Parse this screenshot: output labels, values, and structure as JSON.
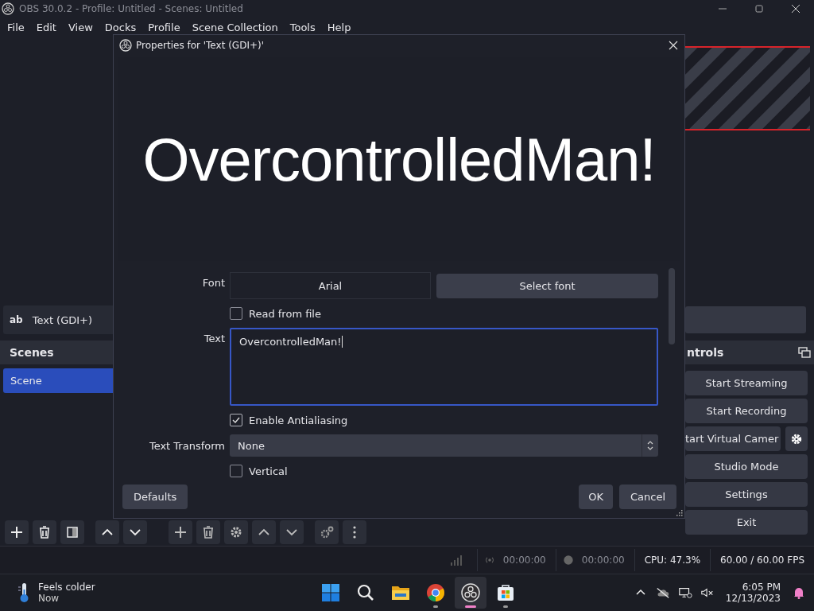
{
  "window": {
    "title": "OBS 30.0.2 - Profile: Untitled - Scenes: Untitled"
  },
  "menu": [
    "File",
    "Edit",
    "View",
    "Docks",
    "Profile",
    "Scene Collection",
    "Tools",
    "Help"
  ],
  "source_bar": {
    "badge": "ab",
    "label": "Text (GDI+)"
  },
  "scenes_dock": {
    "title": "Scenes",
    "items": [
      {
        "label": "Scene",
        "selected": true
      }
    ]
  },
  "controls_dock": {
    "title": "ntrols",
    "buttons": [
      {
        "label": "Start Streaming",
        "kind": "plain"
      },
      {
        "label": "Start Recording",
        "kind": "plain"
      },
      {
        "label": "tart Virtual Camer",
        "kind": "split"
      },
      {
        "label": "Studio Mode",
        "kind": "plain"
      },
      {
        "label": "Settings",
        "kind": "plain"
      },
      {
        "label": "Exit",
        "kind": "plain"
      }
    ]
  },
  "dialog": {
    "title": "Properties for 'Text (GDI+)'",
    "preview_text": "OvercontrolledMan!",
    "font": {
      "label": "Font",
      "value": "Arial",
      "button": "Select font"
    },
    "read_from_file": {
      "label": "Read from file",
      "checked": false
    },
    "text": {
      "label": "Text",
      "value": "OvercontrolledMan!"
    },
    "antialiasing": {
      "label": "Enable Antialiasing",
      "checked": true
    },
    "text_transform": {
      "label": "Text Transform",
      "value": "None"
    },
    "vertical": {
      "label": "Vertical",
      "checked": false
    },
    "buttons": {
      "defaults": "Defaults",
      "ok": "OK",
      "cancel": "Cancel"
    }
  },
  "status_bar": {
    "stream_time": "00:00:00",
    "record_time": "00:00:00",
    "cpu": "CPU: 47.3%",
    "fps": "60.00 / 60.00 FPS"
  },
  "taskbar": {
    "weather": {
      "title": "Feels colder",
      "subtitle": "Now"
    },
    "apps": [
      {
        "kind": "start",
        "running": false,
        "active": false
      },
      {
        "kind": "search",
        "running": false,
        "active": false
      },
      {
        "kind": "folder",
        "running": false,
        "active": false
      },
      {
        "kind": "browser",
        "running": true,
        "active": false
      },
      {
        "kind": "obs",
        "running": true,
        "active": true
      },
      {
        "kind": "store",
        "running": true,
        "active": false
      }
    ],
    "time": "6:05 PM",
    "date": "12/13/2023"
  }
}
